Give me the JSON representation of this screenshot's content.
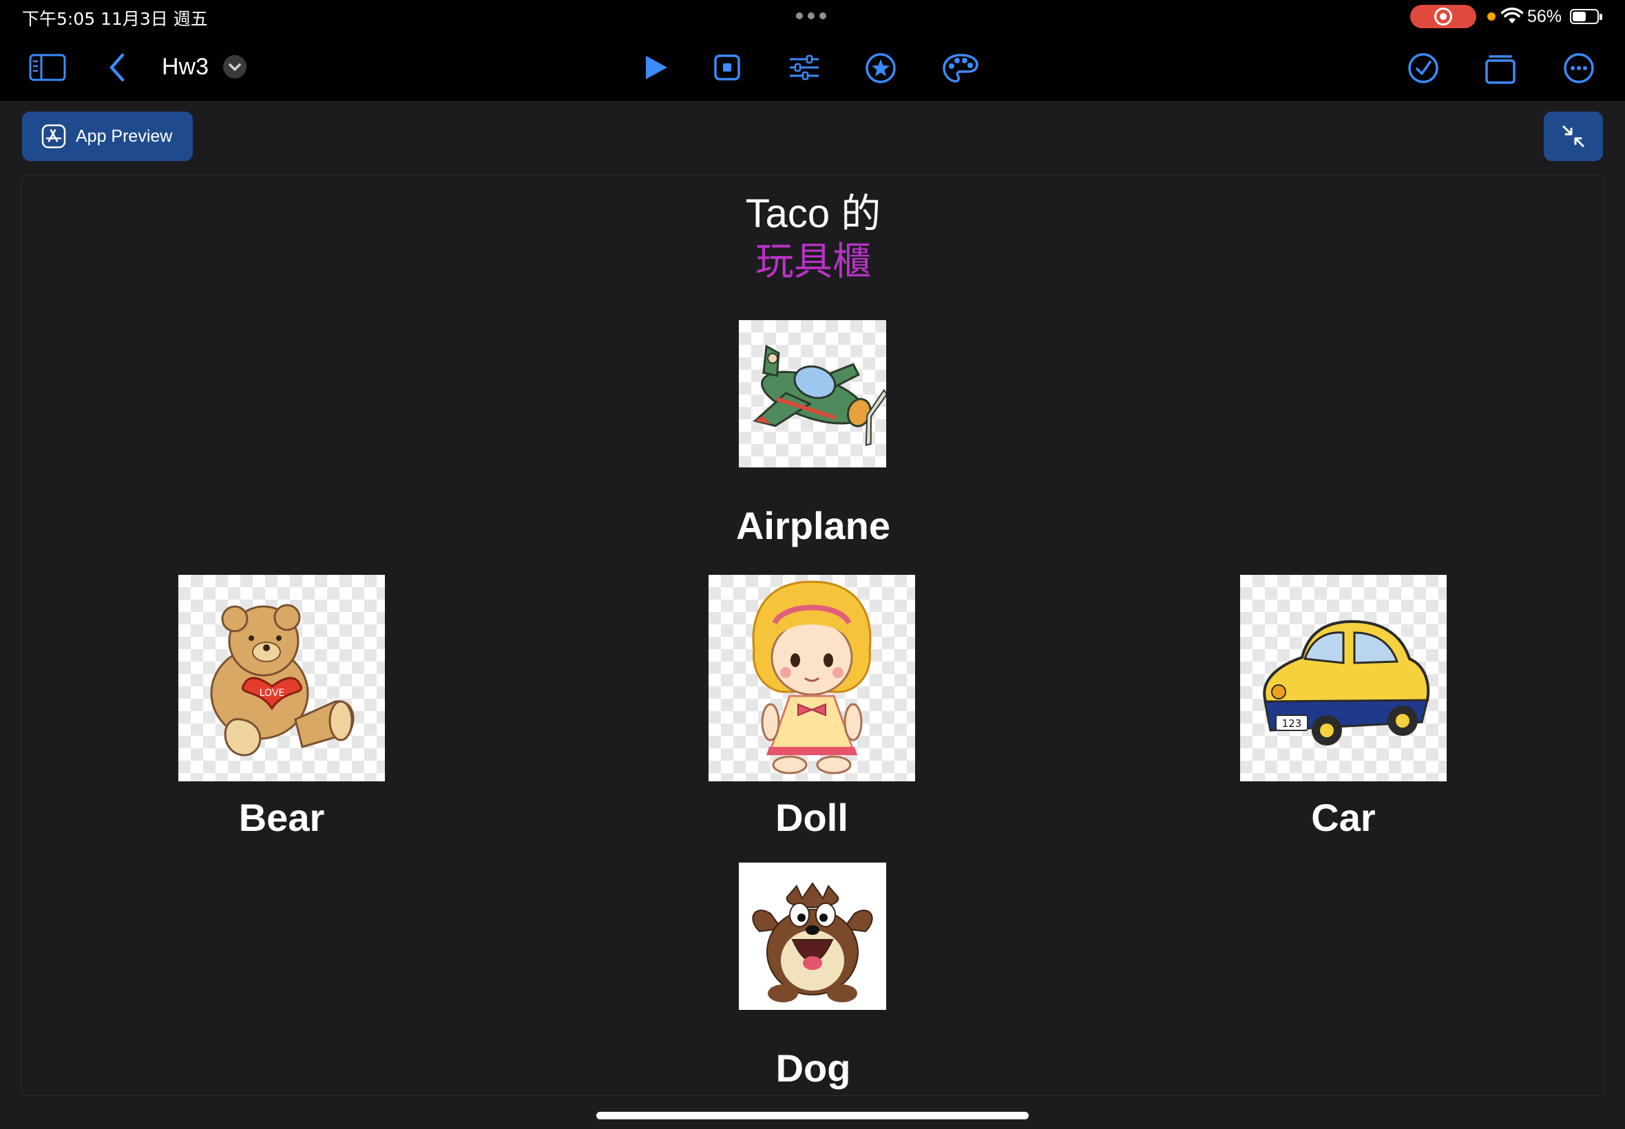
{
  "status_bar": {
    "time": "下午5:05   11月3日 週五",
    "battery": "56%",
    "battery_level": 0.56
  },
  "toolbar": {
    "title": "Hw3"
  },
  "preview": {
    "button_label": "App Preview"
  },
  "app": {
    "title_line1": "Taco 的",
    "title_line2": "玩具櫃",
    "accent_color": "#b733c4",
    "toys": {
      "airplane": "Airplane",
      "bear": "Bear",
      "doll": "Doll",
      "car": "Car",
      "dog": "Dog"
    }
  },
  "colors": {
    "background": "#1c1c1e",
    "toolbar": "#000000",
    "tint": "#3d8bfd",
    "button_fill": "#1f4b8e"
  },
  "icons": [
    "sidebar-icon",
    "back-chevron-icon",
    "chevron-down-icon",
    "play-icon",
    "stop-icon",
    "sliders-icon",
    "star-icon",
    "palette-icon",
    "checkmark-circle-icon",
    "pages-icon",
    "more-icon",
    "app-store-icon",
    "collapse-icon",
    "wifi-icon",
    "record-icon"
  ]
}
